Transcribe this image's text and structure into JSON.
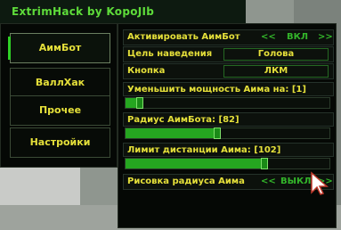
{
  "title": "ExtrimHack by KopoJIb",
  "tabs": [
    {
      "label": "АимБот",
      "active": true
    },
    {
      "label": "ВаллХак",
      "active": false
    },
    {
      "label": "Прочее",
      "active": false
    },
    {
      "label": "Настройки",
      "active": false
    }
  ],
  "aimbot": {
    "activate": {
      "label": "Активировать АимБот",
      "left": "<<",
      "value": "ВКЛ",
      "right": ">>"
    },
    "target": {
      "label": "Цель наведения",
      "value": "Голова"
    },
    "key": {
      "label": "Кнопка",
      "value": "ЛКМ"
    },
    "power": {
      "label": "Уменьшить мощность Аима на: [1]",
      "level": 0.07
    },
    "radius": {
      "label": "Радиус АимБота: [82]",
      "level": 0.45
    },
    "distance": {
      "label": "Лимит дистанции Аима: [102]",
      "level": 0.68
    },
    "draw_radius": {
      "label": "Рисовка радиуса Аима",
      "left": "<<",
      "value": "ВЫКЛ",
      "right": ">>"
    }
  },
  "colors": {
    "accent_green": "#2fd126",
    "text_yellow": "#e5e03a",
    "title_green": "#5edc3a",
    "panel_bg": "#050805"
  }
}
